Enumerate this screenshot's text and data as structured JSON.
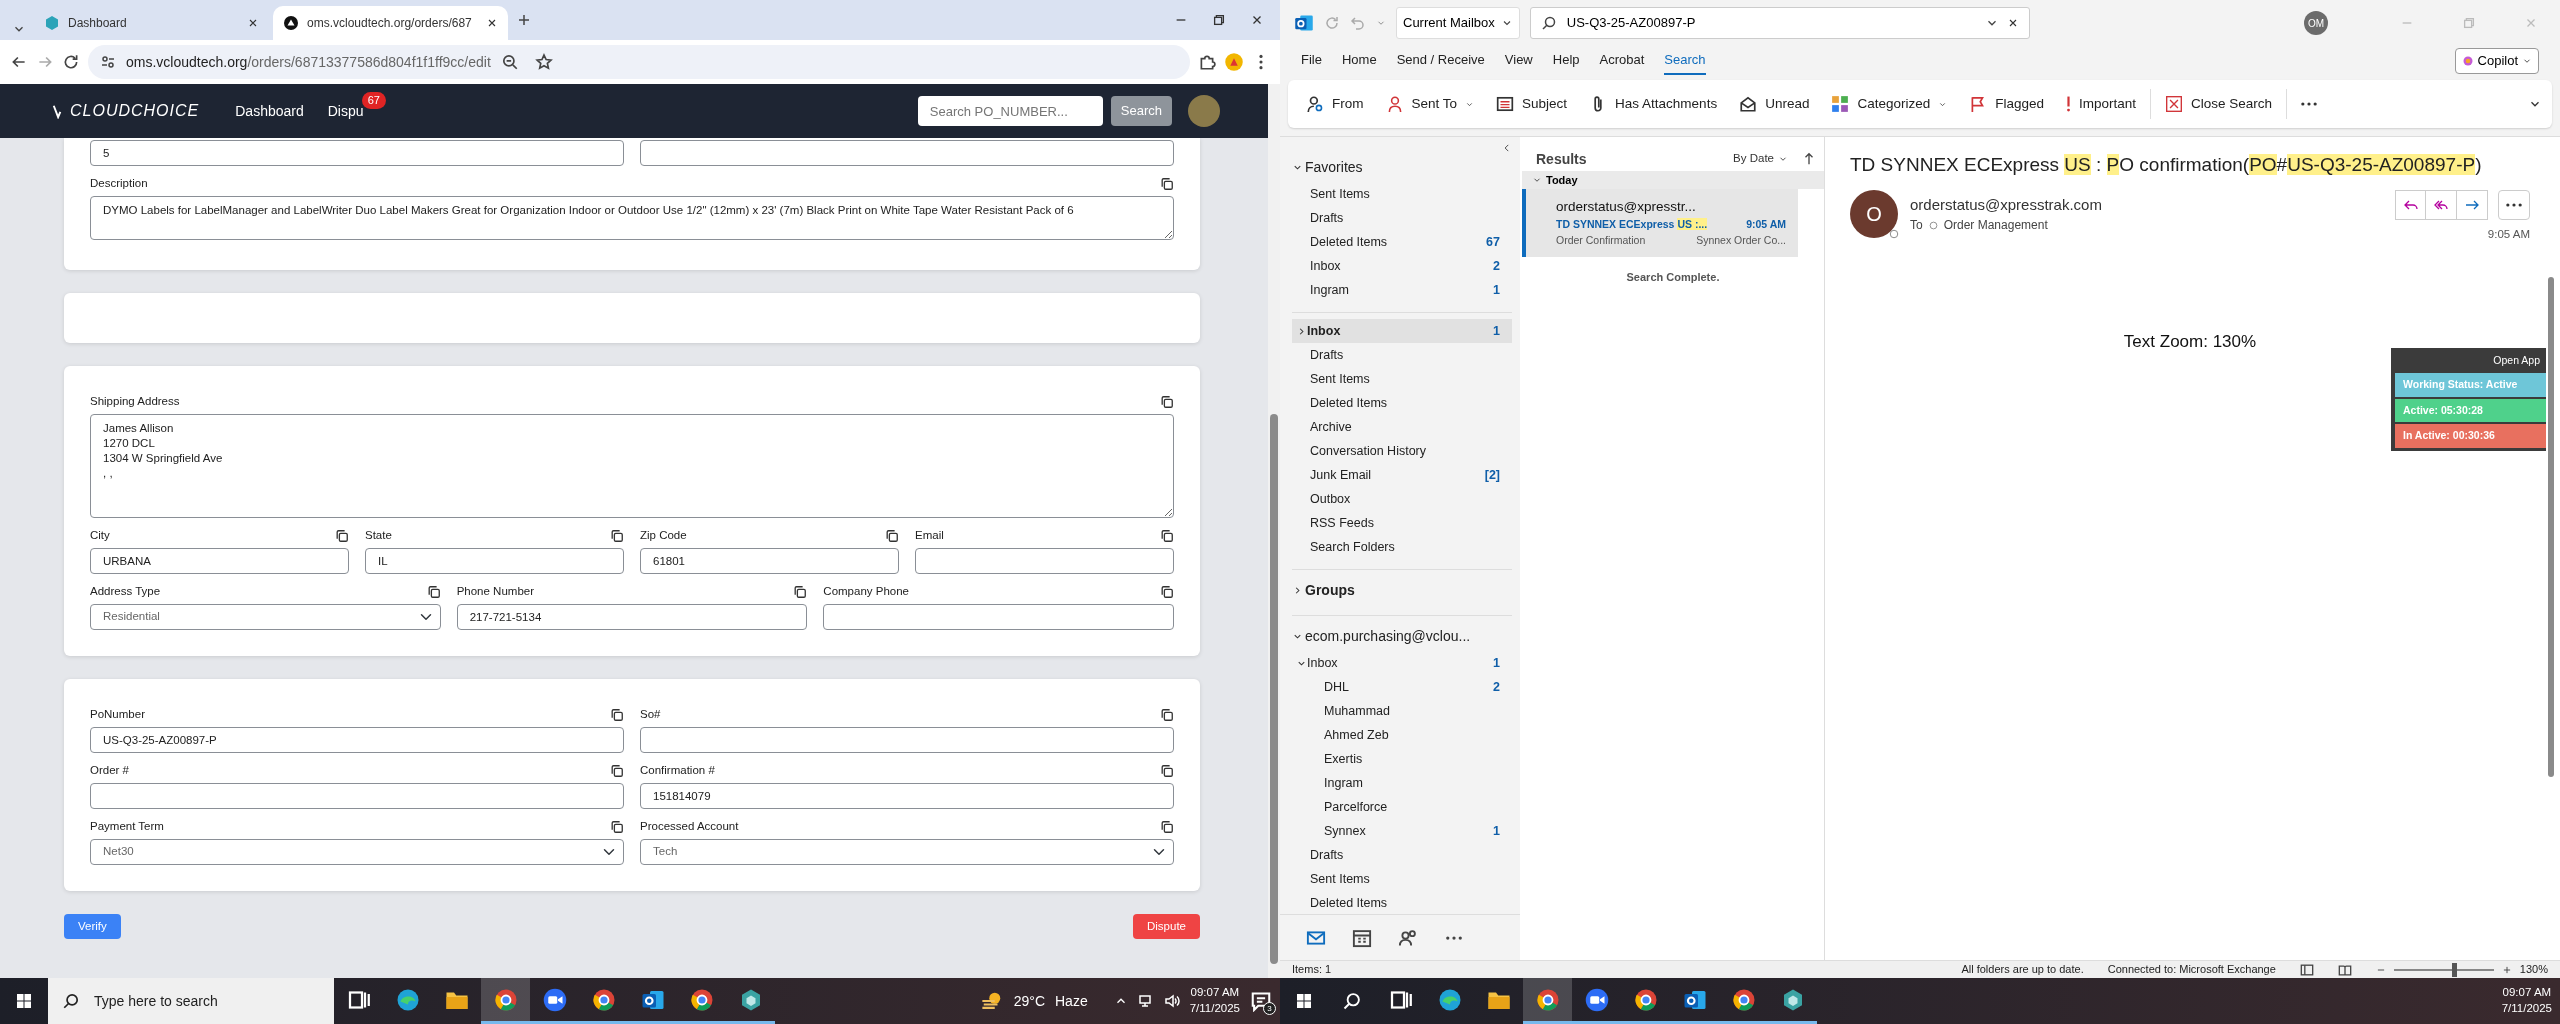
{
  "browser": {
    "tabs": [
      {
        "title": "Dashboard",
        "selected": false
      },
      {
        "title": "oms.vcloudtech.org/orders/687",
        "selected": true
      }
    ],
    "url_host": "oms.vcloudtech.org",
    "url_path": "/orders/68713377586d804f1f1ff9cc/edit"
  },
  "app": {
    "brand": "CLOUDCHOICE",
    "nav_links": [
      {
        "label": "Dashboard"
      },
      {
        "label": "Dispu",
        "badge": "67"
      }
    ],
    "search": {
      "placeholder": "Search PO_NUMBER..."
    },
    "search_button": "Search",
    "cards": [
      {
        "kind": "form",
        "rows": [
          [
            {
              "kind": "input",
              "value": "5"
            },
            {
              "kind": "input"
            }
          ],
          [
            {
              "label": "Description",
              "kind": "textarea",
              "value": "DYMO Labels for LabelManager and LabelWriter Duo Label Makers Great for Organization Indoor or Outdoor Use 1/2\" (12mm) x 23' (7m) Black Print on White Tape Water Resistant Pack of 6"
            }
          ]
        ]
      },
      {
        "kind": "blank"
      },
      {
        "kind": "form",
        "rows": [
          [
            {
              "label": "Shipping Address",
              "kind": "textarea",
              "value": "James Allison\n1270 DCL\n1304 W Springfield Ave\n, ,"
            }
          ],
          [
            {
              "label": "City",
              "kind": "input",
              "value": "URBANA"
            },
            {
              "label": "State",
              "kind": "input",
              "value": "IL"
            },
            {
              "label": "Zip Code",
              "kind": "input",
              "value": "61801"
            },
            {
              "label": "Email",
              "kind": "input"
            }
          ],
          [
            {
              "label": "Address Type",
              "kind": "select",
              "value": "Residential"
            },
            {
              "label": "Phone Number",
              "kind": "input",
              "value": "217-721-5134"
            },
            {
              "label": "Company Phone",
              "kind": "input"
            }
          ]
        ]
      },
      {
        "kind": "form",
        "rows": [
          [
            {
              "label": "PoNumber",
              "kind": "input",
              "value": "US-Q3-25-AZ00897-P"
            },
            {
              "label": "So#",
              "kind": "input"
            }
          ],
          [
            {
              "label": "Order #",
              "kind": "input"
            },
            {
              "label": "Confirmation #",
              "kind": "input",
              "value": "151814079"
            }
          ],
          [
            {
              "label": "Payment Term",
              "kind": "select",
              "value": "Net30"
            },
            {
              "label": "Processed Account",
              "kind": "select",
              "value": "Tech"
            }
          ]
        ]
      }
    ],
    "buttons": [
      {
        "label": "Verify",
        "kind": "primary"
      },
      {
        "label": "Dispute",
        "kind": "danger"
      }
    ]
  },
  "outlook": {
    "search_scope": "Current Mailbox",
    "search_query": "US-Q3-25-AZ00897-P",
    "account_initials": "OM",
    "menu": [
      {
        "label": "File",
        "selected": false
      },
      {
        "label": "Home",
        "selected": false
      },
      {
        "label": "Send / Receive",
        "selected": false
      },
      {
        "label": "View",
        "selected": false
      },
      {
        "label": "Help",
        "selected": false
      },
      {
        "label": "Acrobat",
        "selected": false
      },
      {
        "label": "Search",
        "selected": true
      }
    ],
    "copilot": "Copilot",
    "ribbon": [
      {
        "kind": "from",
        "label": "From"
      },
      {
        "kind": "sentto",
        "label": "Sent To",
        "dropdown": true
      },
      {
        "kind": "subject",
        "label": "Subject"
      },
      {
        "kind": "attach",
        "label": "Has Attachments"
      },
      {
        "kind": "unread",
        "label": "Unread"
      },
      {
        "kind": "categorized",
        "label": "Categorized",
        "dropdown": true
      },
      {
        "kind": "flagged",
        "label": "Flagged"
      },
      {
        "kind": "important",
        "label": "Important"
      },
      {
        "kind": "close",
        "label": "Close Search"
      },
      {
        "kind": "more"
      }
    ],
    "folder_sections": [
      {
        "title": "Favorites",
        "expanded": true,
        "folders": [
          {
            "label": "Sent Items",
            "selected": false
          },
          {
            "label": "Drafts",
            "selected": false
          },
          {
            "label": "Deleted Items",
            "count": "67",
            "selected": false
          },
          {
            "label": "Inbox",
            "count": "2",
            "selected": false
          },
          {
            "label": "Ingram",
            "count": "1",
            "selected": false
          }
        ]
      },
      {
        "folders": [
          {
            "label": "Inbox",
            "count": "1",
            "expanded": false,
            "selected": true
          },
          {
            "label": "Drafts",
            "selected": false
          },
          {
            "label": "Sent Items",
            "selected": false
          },
          {
            "label": "Deleted Items",
            "selected": false
          },
          {
            "label": "Archive",
            "selected": false
          },
          {
            "label": "Conversation History",
            "selected": false
          },
          {
            "label": "Junk Email",
            "count": "[2]",
            "selected": false
          },
          {
            "label": "Outbox",
            "selected": false
          },
          {
            "label": "RSS Feeds",
            "selected": false
          },
          {
            "label": "Search Folders",
            "selected": false
          }
        ]
      },
      {
        "title": "Groups",
        "expanded": false
      },
      {
        "title": "ecom.purchasing@vclou...",
        "expanded": true,
        "folders": [
          {
            "label": "Inbox",
            "count": "1",
            "expanded": true,
            "selected": false,
            "children": [
              {
                "label": "DHL",
                "count": "2",
                "selected": false
              },
              {
                "label": "Muhammad",
                "selected": false
              },
              {
                "label": "Ahmed Zeb",
                "selected": false
              },
              {
                "label": "Exertis",
                "selected": false
              },
              {
                "label": "Ingram",
                "selected": false
              },
              {
                "label": "Parcelforce",
                "selected": false
              },
              {
                "label": "Synnex",
                "count": "1",
                "selected": false
              }
            ]
          },
          {
            "label": "Drafts",
            "selected": false
          },
          {
            "label": "Sent Items",
            "selected": false
          },
          {
            "label": "Deleted Items",
            "selected": false
          }
        ]
      }
    ],
    "results": {
      "title": "Results",
      "sort": "By Date",
      "groups": [
        {
          "title": "Today",
          "expanded": true,
          "messages": [
            {
              "sender": "orderstatus@xpresstr...",
              "subject": [
                {
                  "text": "TD SYNNEX ECExpress ",
                  "highlight": false
                },
                {
                  "text": "US :...",
                  "highlight": true
                }
              ],
              "time": "9:05 AM",
              "preview": "Order Confirmation",
              "folder": "Synnex Order Co...",
              "selected": true
            }
          ]
        }
      ],
      "status": "Search Complete."
    },
    "reading": {
      "subject": [
        {
          "text": "TD SYNNEX ECExpress ",
          "highlight": false
        },
        {
          "text": "US",
          "highlight": true
        },
        {
          "text": " : ",
          "highlight": false
        },
        {
          "text": "P",
          "highlight": true
        },
        {
          "text": "O confirmation(",
          "highlight": false
        },
        {
          "text": "PO",
          "highlight": true
        },
        {
          "text": "#",
          "highlight": false
        },
        {
          "text": "US-Q3-25-AZ00897-P",
          "highlight": true
        },
        {
          "text": ")",
          "highlight": false
        }
      ],
      "avatar": "O",
      "from": "orderstatus@xpresstrak.com",
      "to_label": "To",
      "to": "Order Management",
      "time": "9:05 AM",
      "body": "Text Zoom: 130%"
    },
    "tracker": {
      "open_app": "Open App",
      "statuses": [
        {
          "text": "Working Status: Active",
          "color": "#6ec6d8"
        },
        {
          "text": "Active: 05:30:28",
          "color": "#4fd18b"
        },
        {
          "text": "In Active: 00:30:36",
          "color": "#e8705f"
        }
      ]
    },
    "status_bar": {
      "items": "Items: 1",
      "sync": "All folders are up to date.",
      "connection": "Connected to: Microsoft Exchange",
      "zoom": "130%",
      "zoom_level": {
        "level": 0.6
      }
    }
  },
  "taskbars": [
    {
      "search_placeholder": "Type here to search",
      "apps": [
        {
          "kind": "taskview",
          "running": false,
          "selected": false
        },
        {
          "kind": "edge",
          "running": false,
          "selected": false
        },
        {
          "kind": "explorer",
          "running": false,
          "selected": false
        },
        {
          "kind": "chrome",
          "running": true,
          "selected": true
        },
        {
          "kind": "zoom",
          "running": true,
          "selected": false
        },
        {
          "kind": "chrome",
          "running": true,
          "selected": false
        },
        {
          "kind": "outlook",
          "running": true,
          "selected": false
        },
        {
          "kind": "chrome",
          "running": true,
          "selected": false
        },
        {
          "kind": "app",
          "running": true,
          "selected": false
        }
      ],
      "weather": {
        "temp": "29°C",
        "condition": "Haze"
      },
      "time": "09:07 AM",
      "date": "7/11/2025",
      "notifications": "3"
    },
    {
      "apps": [
        {
          "kind": "taskview",
          "running": false,
          "selected": false
        },
        {
          "kind": "edge",
          "running": false,
          "selected": false
        },
        {
          "kind": "explorer",
          "running": false,
          "selected": false
        },
        {
          "kind": "chrome",
          "running": true,
          "selected": true
        },
        {
          "kind": "zoom",
          "running": true,
          "selected": false
        },
        {
          "kind": "chrome",
          "running": true,
          "selected": false
        },
        {
          "kind": "outlook",
          "running": true,
          "selected": false
        },
        {
          "kind": "chrome",
          "running": true,
          "selected": false
        },
        {
          "kind": "app",
          "running": true,
          "selected": false
        }
      ],
      "time": "09:07 AM",
      "date": "7/11/2025"
    }
  ]
}
